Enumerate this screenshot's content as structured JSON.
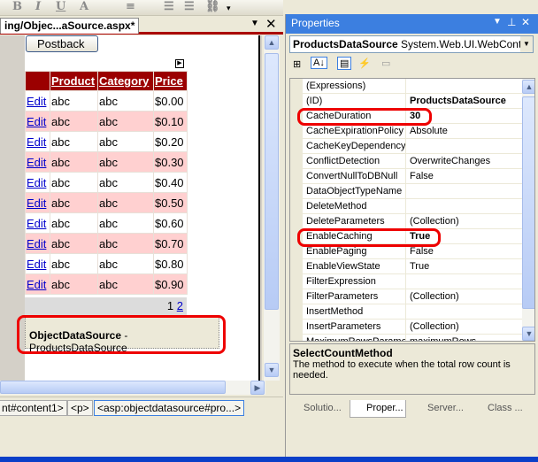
{
  "toolbar": {
    "bold": "B",
    "italic": "I",
    "underline": "U"
  },
  "editor": {
    "tab_title": "ing/Objec...aSource.aspx*",
    "postback_label": "Postback",
    "grid": {
      "headers": [
        "",
        "Product",
        "Category",
        "Price"
      ],
      "rows": [
        [
          "Edit",
          "abc",
          "abc",
          "$0.00"
        ],
        [
          "Edit",
          "abc",
          "abc",
          "$0.10"
        ],
        [
          "Edit",
          "abc",
          "abc",
          "$0.20"
        ],
        [
          "Edit",
          "abc",
          "abc",
          "$0.30"
        ],
        [
          "Edit",
          "abc",
          "abc",
          "$0.40"
        ],
        [
          "Edit",
          "abc",
          "abc",
          "$0.50"
        ],
        [
          "Edit",
          "abc",
          "abc",
          "$0.60"
        ],
        [
          "Edit",
          "abc",
          "abc",
          "$0.70"
        ],
        [
          "Edit",
          "abc",
          "abc",
          "$0.80"
        ],
        [
          "Edit",
          "abc",
          "abc",
          "$0.90"
        ]
      ],
      "pager": {
        "current": "1",
        "next": "2"
      }
    },
    "ods": {
      "type": "ObjectDataSource",
      "sep": " - ",
      "name": "ProductsDataSource"
    },
    "breadcrumbs": [
      "nt#content1>",
      "<p>",
      "<asp:objectdatasource#pro...>"
    ]
  },
  "properties": {
    "title": "Properties",
    "object_name": "ProductsDataSource",
    "object_type": "System.Web.UI.WebControl",
    "rows": [
      {
        "name": "(Expressions)",
        "value": ""
      },
      {
        "name": "(ID)",
        "value": "ProductsDataSource",
        "bold": true
      },
      {
        "name": "CacheDuration",
        "value": "30",
        "bold": true
      },
      {
        "name": "CacheExpirationPolicy",
        "value": "Absolute"
      },
      {
        "name": "CacheKeyDependency",
        "value": ""
      },
      {
        "name": "ConflictDetection",
        "value": "OverwriteChanges"
      },
      {
        "name": "ConvertNullToDBNull",
        "value": "False"
      },
      {
        "name": "DataObjectTypeName",
        "value": ""
      },
      {
        "name": "DeleteMethod",
        "value": ""
      },
      {
        "name": "DeleteParameters",
        "value": "(Collection)"
      },
      {
        "name": "EnableCaching",
        "value": "True",
        "bold": true
      },
      {
        "name": "EnablePaging",
        "value": "False"
      },
      {
        "name": "EnableViewState",
        "value": "True"
      },
      {
        "name": "FilterExpression",
        "value": ""
      },
      {
        "name": "FilterParameters",
        "value": "(Collection)"
      },
      {
        "name": "InsertMethod",
        "value": ""
      },
      {
        "name": "InsertParameters",
        "value": "(Collection)"
      },
      {
        "name": "MaximumRowsParamet",
        "value": "maximumRows"
      }
    ],
    "description": {
      "title": "SelectCountMethod",
      "text": "The method to execute when the total row count is needed."
    },
    "tabs": [
      "Solutio...",
      "Proper...",
      "Server...",
      "Class ..."
    ]
  },
  "colors": {
    "header": "#9b0000",
    "alt_row": "#ffd0d0",
    "highlight": "#e00000",
    "title_bar": "#3c7fe0"
  }
}
